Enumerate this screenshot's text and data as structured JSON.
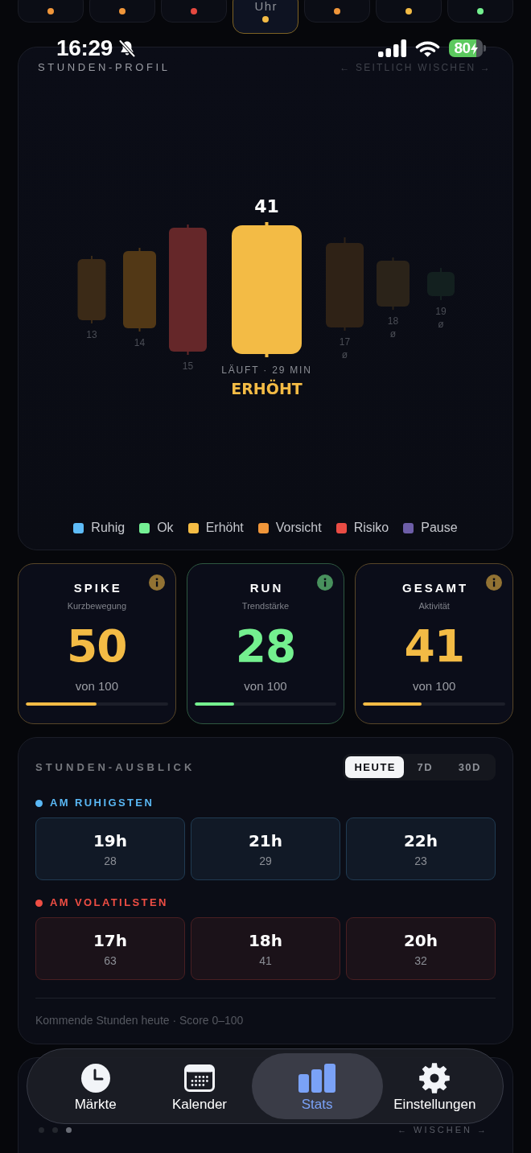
{
  "status_bar": {
    "time": "16:29",
    "battery": "80"
  },
  "hour_tiles": [
    {
      "color": "#f0963a",
      "selected": false
    },
    {
      "color": "#f0963a",
      "selected": false
    },
    {
      "color": "#e5483f",
      "selected": false
    },
    {
      "label": "Uhr",
      "color": "#f3bb45",
      "selected": true
    },
    {
      "color": "#f0963a",
      "selected": false
    },
    {
      "color": "#f3bb45",
      "selected": false
    },
    {
      "color": "#74f08f",
      "selected": false
    }
  ],
  "profile": {
    "title": "STUNDEN-PROFIL",
    "hint": "← SEITLICH WISCHEN →",
    "candles": [
      {
        "kind": "past",
        "hour": "13",
        "color": "#3b2a17"
      },
      {
        "kind": "past",
        "hour": "14",
        "color": "#523816"
      },
      {
        "kind": "past",
        "hour": "15",
        "color": "#652729"
      },
      {
        "kind": "current",
        "value": "41",
        "elapsed": "LÄUFT · 29 MIN",
        "status": "ERHÖHT",
        "color": "#f3bb45"
      },
      {
        "kind": "forecast",
        "hour": "17",
        "mark": "ø",
        "color": "#2f2216"
      },
      {
        "kind": "forecast",
        "hour": "18",
        "mark": "ø",
        "color": "#2b2319"
      },
      {
        "kind": "forecast",
        "hour": "19",
        "mark": "ø",
        "color": "#13201f"
      }
    ],
    "legend": [
      {
        "label": "Ruhig",
        "color": "#5ebcf8"
      },
      {
        "label": "Ok",
        "color": "#74f094"
      },
      {
        "label": "Erhöht",
        "color": "#f5bd45"
      },
      {
        "label": "Vorsicht",
        "color": "#f0963a"
      },
      {
        "label": "Risiko",
        "color": "#e94c44"
      },
      {
        "label": "Pause",
        "color": "#6d5ea8"
      }
    ]
  },
  "scores": [
    {
      "title": "SPIKE",
      "subtitle": "Kurzbewegung",
      "value": "50",
      "scale": "von 100",
      "level": 0.5,
      "color": "#f3bb45"
    },
    {
      "title": "RUN",
      "subtitle": "Trendstärke",
      "value": "28",
      "scale": "von 100",
      "level": 0.28,
      "color": "#74f08f"
    },
    {
      "title": "GESAMT",
      "subtitle": "Aktivität",
      "value": "41",
      "scale": "von 100",
      "level": 0.41,
      "color": "#f3bb45"
    }
  ],
  "outlook": {
    "title": "STUNDEN-AUSBLICK",
    "ranges": [
      {
        "label": "HEUTE",
        "selected": true
      },
      {
        "label": "7D",
        "selected": false
      },
      {
        "label": "30D",
        "selected": false
      }
    ],
    "groups": [
      {
        "title": "AM RUHIGSTEN",
        "color": "#5ab8f5",
        "hours": [
          {
            "hour": "19h",
            "score": "28"
          },
          {
            "hour": "21h",
            "score": "29"
          },
          {
            "hour": "22h",
            "score": "23"
          }
        ]
      },
      {
        "title": "AM VOLATILSTEN",
        "color": "#ef4e44",
        "hours": [
          {
            "hour": "17h",
            "score": "63"
          },
          {
            "hour": "18h",
            "score": "41"
          },
          {
            "hour": "20h",
            "score": "32"
          }
        ]
      }
    ],
    "footnote": "Kommende Stunden heute · Score 0–100"
  },
  "next_card": {
    "hint": "← WISCHEN →",
    "pages": [
      {
        "selected": false
      },
      {
        "selected": false
      },
      {
        "selected": true
      }
    ]
  },
  "tab_bar": [
    {
      "kind": "clock",
      "label": "Märkte",
      "selected": false
    },
    {
      "kind": "calendar",
      "label": "Kalender",
      "selected": false
    },
    {
      "kind": "chart",
      "label": "Stats",
      "selected": true
    },
    {
      "kind": "gear",
      "label": "Einstellungen",
      "selected": false
    }
  ]
}
